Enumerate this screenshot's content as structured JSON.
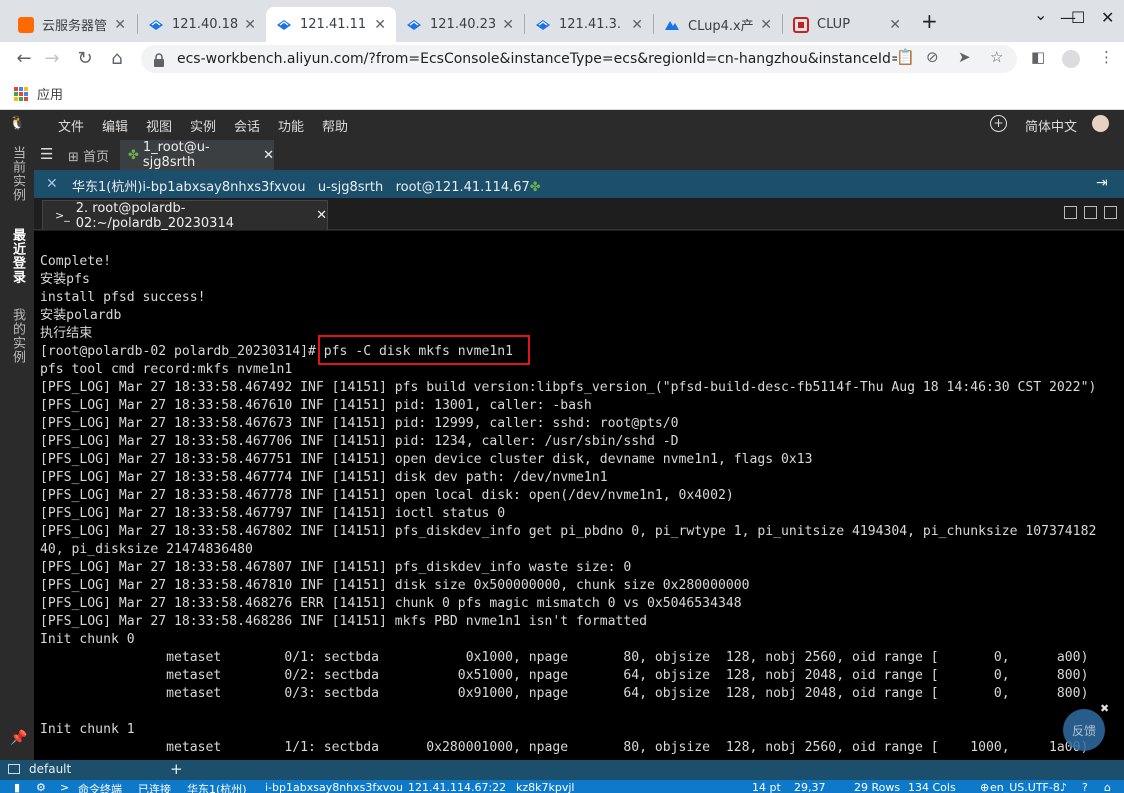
{
  "browser": {
    "tabs": [
      {
        "label": "云服务器管",
        "favicon_color": "#ff6a00"
      },
      {
        "label": "121.40.18",
        "favicon_color": "#1a73e8"
      },
      {
        "label": "121.41.11",
        "favicon_color": "#1a73e8"
      },
      {
        "label": "121.40.23",
        "favicon_color": "#1a73e8"
      },
      {
        "label": "121.41.3.",
        "favicon_color": "#1a73e8"
      },
      {
        "label": "CLup4.x产",
        "favicon_color": "#1a73e8"
      },
      {
        "label": "CLUP",
        "favicon_color": "#c5221f"
      }
    ],
    "active_tab_index": 2,
    "new_tab_symbol": "+",
    "window_controls": {
      "collapse": "⌄",
      "minimize": "—",
      "maximize": "☐",
      "close": "✕"
    },
    "url": "ecs-workbench.aliyun.com/?from=EcsConsole&instanceType=ecs&regionId=cn-hangzhou&instanceId=i-bp1abx…",
    "bookmarks": {
      "apps_label": "应用"
    }
  },
  "workbench": {
    "menu": [
      "文件",
      "编辑",
      "视图",
      "实例",
      "会话",
      "功能",
      "帮助"
    ],
    "language": "简体中文",
    "rail": {
      "items": [
        {
          "label": "当前实例",
          "active": false
        },
        {
          "label": "最近登录",
          "active": true
        },
        {
          "label": "我的实例",
          "active": false
        }
      ]
    },
    "session_tabs": {
      "home": "首页",
      "active": "1_root@u-sjg8srth",
      "close_symbol": "✕"
    },
    "info_bar": {
      "region": "华东1(杭州)i-bp1abxsay8nhxs3fxvou",
      "host": "u-sjg8srth",
      "login": "root@121.41.114.67"
    },
    "terminal_tab": {
      "label": "2. root@polardb-02:~/polardb_20230314",
      "prompt_symbol": ">_",
      "close_symbol": "✕"
    },
    "terminal_lines": [
      "Complete!",
      "安装pfs",
      "install pfsd success!",
      "安装polardb",
      "执行结束",
      "[root@polardb-02 polardb_20230314]# pfs -C disk mkfs nvme1n1",
      "pfs tool cmd record:mkfs nvme1n1",
      "[PFS_LOG] Mar 27 18:33:58.467492 INF [14151] pfs build version:libpfs_version_(\"pfsd-build-desc-fb5114f-Thu Aug 18 14:46:30 CST 2022\")",
      "[PFS_LOG] Mar 27 18:33:58.467610 INF [14151] pid: 13001, caller: -bash",
      "[PFS_LOG] Mar 27 18:33:58.467673 INF [14151] pid: 12999, caller: sshd: root@pts/0",
      "[PFS_LOG] Mar 27 18:33:58.467706 INF [14151] pid: 1234, caller: /usr/sbin/sshd -D",
      "[PFS_LOG] Mar 27 18:33:58.467751 INF [14151] open device cluster disk, devname nvme1n1, flags 0x13",
      "[PFS_LOG] Mar 27 18:33:58.467774 INF [14151] disk dev path: /dev/nvme1n1",
      "[PFS_LOG] Mar 27 18:33:58.467778 INF [14151] open local disk: open(/dev/nvme1n1, 0x4002)",
      "[PFS_LOG] Mar 27 18:33:58.467797 INF [14151] ioctl status 0",
      "[PFS_LOG] Mar 27 18:33:58.467802 INF [14151] pfs_diskdev_info get pi_pbdno 0, pi_rwtype 1, pi_unitsize 4194304, pi_chunksize 107374182",
      "40, pi_disksize 21474836480",
      "[PFS_LOG] Mar 27 18:33:58.467807 INF [14151] pfs_diskdev_info waste size: 0",
      "[PFS_LOG] Mar 27 18:33:58.467810 INF [14151] disk size 0x500000000, chunk size 0x280000000",
      "[PFS_LOG] Mar 27 18:33:58.468276 ERR [14151] chunk 0 pfs magic mismatch 0 vs 0x5046534348",
      "[PFS_LOG] Mar 27 18:33:58.468286 INF [14151] mkfs PBD nvme1n1 isn't formatted",
      "Init chunk 0",
      "                metaset        0/1: sectbda           0x1000, npage       80, objsize  128, nobj 2560, oid range [       0,      a00)",
      "                metaset        0/2: sectbda          0x51000, npage       64, objsize  128, nobj 2048, oid range [       0,      800)",
      "                metaset        0/3: sectbda          0x91000, npage       64, objsize  128, nobj 2048, oid range [       0,      800)",
      "",
      "Init chunk 1",
      "                metaset        1/1: sectbda      0x280001000, npage       80, objsize  128, nobj 2560, oid range [    1000,     1a00)"
    ],
    "feedback_label": "反馈",
    "workspace": {
      "name": "default",
      "add_symbol": "+"
    },
    "status_bar": {
      "terminal_label": "命令终端",
      "connection": "已连接",
      "region": "华东1(杭州)",
      "instance": "i-bp1abxsay8nhxs3fxvou",
      "address": "121.41.114.67:22",
      "session_id": "kz8k7kpvjl",
      "font_size": "14 pt",
      "dimensions": "29,37",
      "rows": "29 Rows",
      "cols": "134 Cols",
      "encoding": "en_US.UTF-8"
    }
  }
}
